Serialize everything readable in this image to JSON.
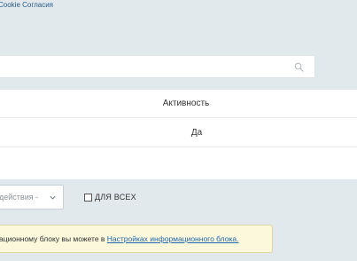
{
  "breadcrumb": {
    "text": "Cookie Согласия"
  },
  "search": {
    "value": "",
    "placeholder": ""
  },
  "table": {
    "headers": {
      "activity": "Активность"
    },
    "rows": [
      {
        "activity": "Да"
      }
    ]
  },
  "actions": {
    "select_label": "действия -",
    "for_all_label": "ДЛЯ ВСЕХ"
  },
  "note": {
    "text": "ационному блоку вы можете в ",
    "link": "Настройках информационного блока."
  },
  "icons": {
    "search": "search-icon",
    "dropdown": "chevron-down-icon"
  }
}
